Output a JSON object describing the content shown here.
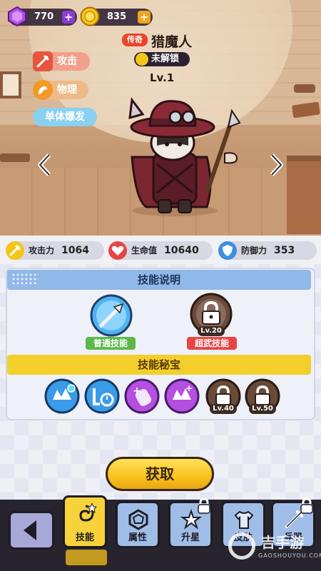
{
  "currency": {
    "gems": "770",
    "coins": "835",
    "gem_icon": "purple-gem-icon",
    "coin_icon": "gold-coin-icon"
  },
  "hero": {
    "rarity": "传奇",
    "name": "猎魔人",
    "lock_status": "未解锁",
    "level": "Lv.1",
    "tags": {
      "attack": "攻击",
      "physical": "物理",
      "burst": "单体爆发"
    }
  },
  "stats": {
    "attack_label": "攻击力",
    "attack_value": "1064",
    "hp_label": "生命值",
    "hp_value": "10640",
    "defense_label": "防御力",
    "defense_value": "353"
  },
  "skills_section": {
    "title": "技能说明",
    "normal_label": "普通技能",
    "super_label": "超武技能",
    "super_level": "Lv.20"
  },
  "treasure_section": {
    "title": "技能秘宝",
    "lock1_level": "Lv.40",
    "lock2_level": "Lv.50"
  },
  "acquire_label": "获取",
  "nav": {
    "skills": "技能",
    "attributes": "属性",
    "star_up": "升星",
    "skin": "皮肤",
    "weapon": "兵器"
  },
  "watermark": {
    "title": "吉手游",
    "subtitle": "GAOSHOUYOU.COM"
  },
  "colors": {
    "accent_yellow": "#f7c21c",
    "blue_header": "#90b8e8",
    "rarity_red": "#e8452a",
    "nav_dark": "#27242e"
  }
}
